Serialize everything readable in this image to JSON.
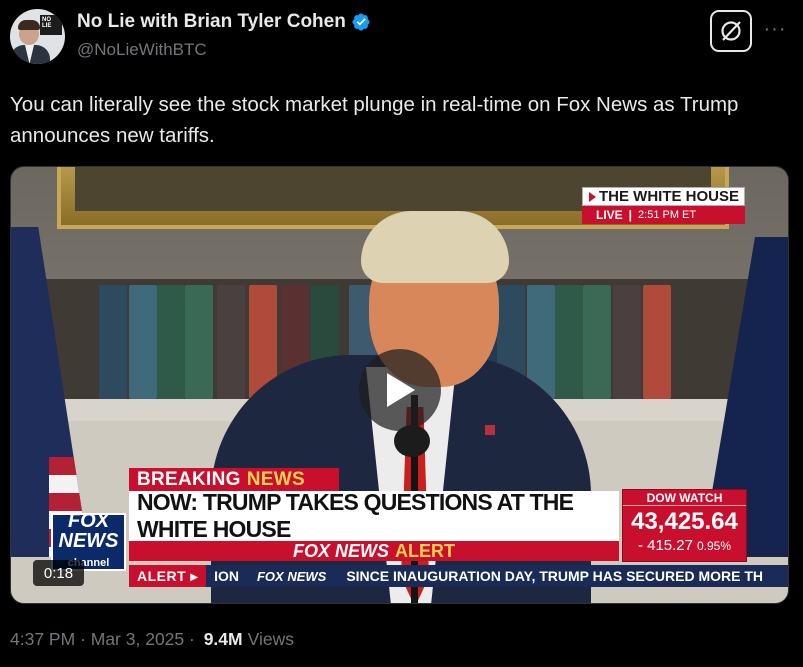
{
  "author": {
    "name": "No Lie with Brian Tyler Cohen",
    "handle": "@NoLieWithBTC",
    "avatar_logo_text": "NO LIE"
  },
  "tweet": {
    "text": "You can literally see the stock market plunge in real-time on Fox News as Trump announces new tariffs."
  },
  "actions": {
    "grok_icon": "grok-icon",
    "more_label": "···"
  },
  "video": {
    "elapsed": "0:18",
    "play_icon": "play-icon",
    "overlay": {
      "location": "THE WHITE HOUSE",
      "live": "LIVE",
      "live_time": "2:51 PM ET",
      "breaking_1": "BREAKING",
      "breaking_2": "NEWS",
      "headline": "NOW: TRUMP TAKES QUESTIONS AT THE WHITE HOUSE",
      "alert_brand": "FOX NEWS",
      "alert_word": "ALERT",
      "dow_label": "DOW WATCH",
      "dow_value": "43,425.64",
      "dow_change": "- 415.27",
      "dow_pct": "0.95%",
      "logo_line1": "FOX",
      "logo_line2": "NEWS",
      "logo_line3": "channel",
      "ticker_alert": "ALERT ▸",
      "ticker_section": "ION",
      "ticker_brand": "FOX NEWS",
      "ticker_crawl": "SINCE INAUGURATION DAY, TRUMP HAS SECURED MORE TH"
    }
  },
  "meta": {
    "time": "4:37 PM",
    "separator": " · ",
    "date": "Mar 3, 2025",
    "separator2": " · ",
    "views_count": "9.4M",
    "views_label": "Views"
  },
  "colors": {
    "background": "#000000",
    "text_primary": "#e7e9ea",
    "text_secondary": "#71767b",
    "verified_blue": "#1d9bf0",
    "fox_red": "#c8102e"
  }
}
